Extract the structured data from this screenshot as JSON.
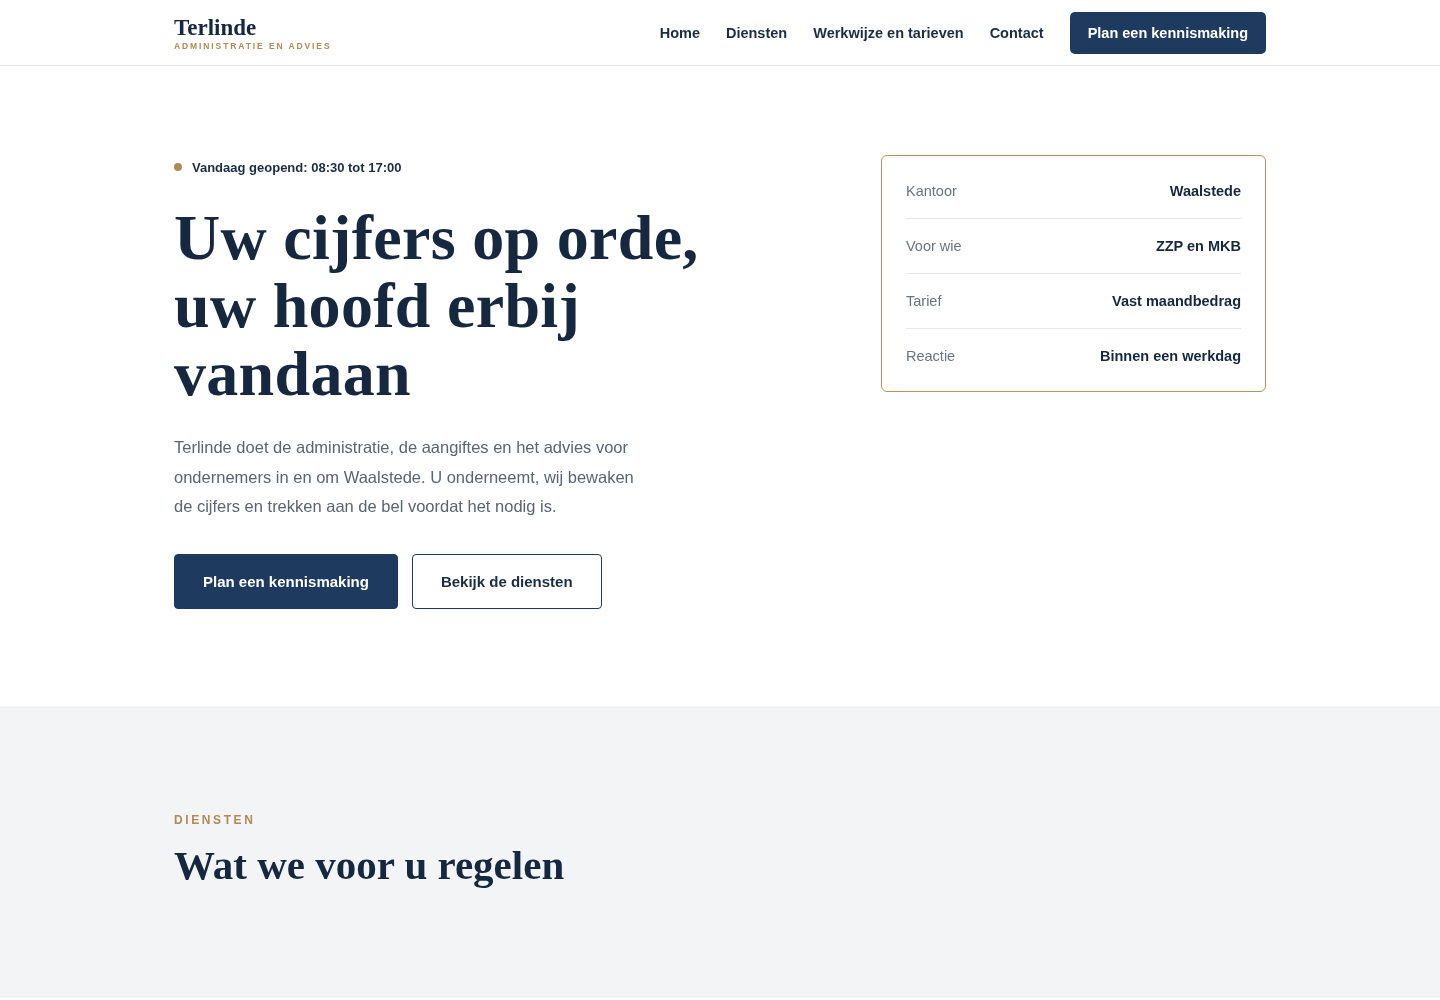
{
  "header": {
    "logo": {
      "name": "Terlinde",
      "tagline": "ADMINISTRATIE EN ADVIES"
    },
    "nav": [
      {
        "label": "Home"
      },
      {
        "label": "Diensten"
      },
      {
        "label": "Werkwijze en tarieven"
      },
      {
        "label": "Contact"
      }
    ],
    "cta": "Plan een kennismaking"
  },
  "hero": {
    "status": "Vandaag geopend: 08:30 tot 17:00",
    "title": "Uw cijfers op orde, uw hoofd erbij vandaan",
    "intro": "Terlinde doet de administratie, de aangiftes en het advies voor ondernemers in en om Waalstede. U onderneemt, wij bewaken de cijfers en trekken aan de bel voordat het nodig is.",
    "buttons": [
      {
        "label": "Plan een kennismaking",
        "kind": "primary"
      },
      {
        "label": "Bekijk de diensten",
        "kind": "outline"
      }
    ]
  },
  "facts": [
    {
      "label": "Kantoor",
      "value": "Waalstede"
    },
    {
      "label": "Voor wie",
      "value": "ZZP en MKB"
    },
    {
      "label": "Tarief",
      "value": "Vast maandbedrag"
    },
    {
      "label": "Reactie",
      "value": "Binnen een werkdag"
    }
  ],
  "services": {
    "eyebrow": "DIENSTEN",
    "title": "Wat we voor u regelen"
  }
}
